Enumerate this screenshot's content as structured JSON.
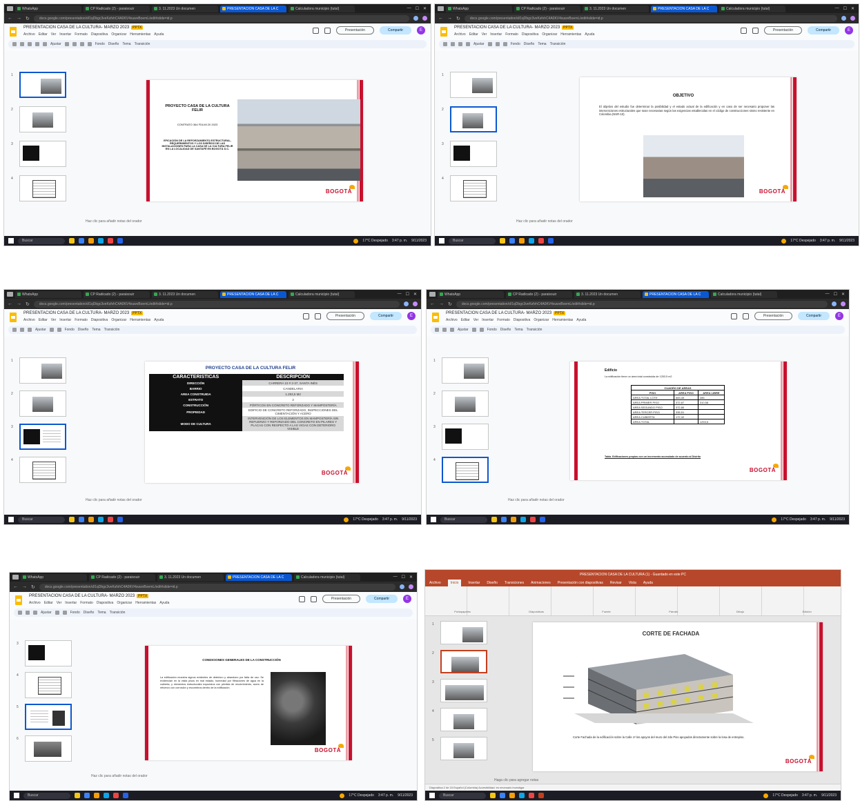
{
  "browser": {
    "tabs": [
      "WhatsApp",
      "CP Radicado (2) - paraisouir",
      "3. 11.2023 Un documen",
      "PRESENTACION CASA DE LA C",
      "Calculadora municipio (tutal)"
    ],
    "url": "docs.google.com/presentation/d/1qDbgc3veKsfvhC4A0KV4xuwvBoemL/edit#slide=id.p"
  },
  "app": {
    "doc_title": "PRESENTACION CASA DE LA CULTURA- MARZO 2023",
    "badge": "PPTX",
    "menus": [
      "Archivo",
      "Editar",
      "Ver",
      "Insertar",
      "Formato",
      "Diapositiva",
      "Organizar",
      "Herramientas",
      "Ayuda"
    ],
    "present_label": "Presentación",
    "share_label": "Compartir",
    "avatar_letter": "E",
    "toolbar_items": [
      "Ajustar",
      "Fondo",
      "Diseño",
      "Tema",
      "Transición"
    ],
    "speaker_notes": "Haz clic para añadir notas del orador"
  },
  "taskbar": {
    "search": "Buscar",
    "weather": "17°C Despejado",
    "time": "3:47 p. m.",
    "date": "9/11/2023"
  },
  "slides": {
    "s1": {
      "title": "PROYECTO CASA DE LA CULTURA FELIR",
      "subtitle": "CONTRATO 364 FDLMI 20 2023",
      "body": "EFICACIÓN DE LA REFORZAMIENTO ESTRUCTURAL, REQUERIMIENTOS Y LOS DISEÑOS DE LAS INSTALACIONES PARA LA CASA DE LA CULTURA FELIR EN LA LOCALIDAD DE SANTAFÉ EN BOGOTÁ D.C."
    },
    "s2": {
      "title": "OBJETIVO",
      "body": "El objetivo del estudio fue determinar la posibilidad y el estado actual de la edificación y en caso de ser necesario proponer las intervenciones estructurales que sean necesarias según las exigencias establecidas en el código de construcciones sismo resistente en Colombia (NSR-10)."
    },
    "s3": {
      "title": "PROYECTO CASA DE LA CULTURA FELIR",
      "col_left": "CARACTERISTICAS",
      "col_right": "DESCRIPCIÓN",
      "rows": [
        {
          "k": "DIRECCIÓN",
          "v": "CARRERA 10 # 2-37, SANTA INÉS"
        },
        {
          "k": "BARRIO",
          "v": "CANDELARIA"
        },
        {
          "k": "AREA CONSTRUIDA",
          "v": "1.253,5 M2"
        },
        {
          "k": "ESTRATO",
          "v": "2"
        },
        {
          "k": "CONSTRUCCIÓN",
          "v": "PÓRTICOS EN CONCRETO REFORZADO Y MAMPOSTERÍA"
        },
        {
          "k": "PROPIEDAD",
          "v": "EDIFICIO DE CONCRETO REFORZADO, INSPECCIONES DEL CIMENTACIÓN Y ACERO"
        },
        {
          "k": "MODO DE CULTURA",
          "v": "INTERVENCIÓN DE LOS ELEMENTOS EN MAMPOSTERÍA SIN REFUERZO Y REFORZADO DEL CONCRETO EN PILARES Y PLACAS CON RESPECTO A LAS VIGAS CON DETERIORO VISIBLE"
        }
      ]
    },
    "s4": {
      "title": "Edificio",
      "caption": "La edificación tiene un área total construida de 1253.5 m2",
      "table_title": "CUADRO DE AREAS",
      "headers": [
        "PISO",
        "AREA PISO",
        "AREA LIBRE"
      ],
      "rows": [
        [
          "AREA TOTAL LOTE",
          "683,45",
          "285"
        ],
        [
          "AREA PRIMER PISO",
          "372,87",
          "310,58"
        ],
        [
          "AREA SEGUNDO PISO",
          "372,80",
          ""
        ],
        [
          "AREA TERCER PISO",
          "335,51",
          ""
        ],
        [
          "AREA CUBIERTA",
          "172,32",
          ""
        ],
        [
          "AREA TOTAL",
          "",
          "1253,5"
        ]
      ],
      "footnote": "Tabla. Edificaciones propias con un incremento acumulado de acuerdo al Distrito"
    },
    "s5": {
      "title": "CONDICIONES GENERALES DE LA CONSTRUCCIÓN",
      "body": "La edificación muestra signos evidentes de deterioro y abandono por falta de uso. Se evidencian en la visita pisos en mal estado, humedad por filtraciones de agua en la cubierta, y elementos estructurales expuestos con pérdida de recubrimiento, acero de refuerzo con corrosión y escombros dentro de la edificación."
    },
    "s6": {
      "title": "CORTE DE FACHADA",
      "caption": "Corte Fachada de la edificación sobre la Calle 1ª los apoyos del muro del 2do Piso apoyados directamente sobre la losa de entrepiso.",
      "window_title": "PRESENTACION CASA DE LA CULTURA (1)  -  Guardado en este PC",
      "tabs": [
        "Archivo",
        "Inicio",
        "Insertar",
        "Diseño",
        "Transiciones",
        "Animaciones",
        "Presentación con diapositivas",
        "Revisar",
        "Vista",
        "Ayuda"
      ],
      "ribbon_groups": [
        "Portapapeles",
        "Diapositivas",
        "Fuente",
        "Párrafo",
        "Dibujo",
        "Edición"
      ],
      "notes": "Haga clic para agregar notas",
      "status": "Diapositiva 2 de 15   Español (Colombia)   Accesibilidad: es necesario investigar"
    }
  },
  "logo": "BOGOTÁ"
}
